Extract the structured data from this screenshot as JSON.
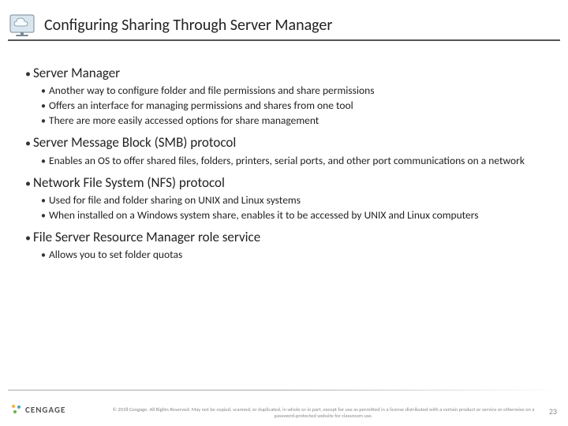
{
  "header": {
    "title": "Configuring Sharing Through Server Manager"
  },
  "icons": {
    "cloud": "cloud-icon",
    "brand_mark": "brand-mark-icon"
  },
  "bullets": [
    {
      "text": "Server Manager",
      "children": [
        "Another way to configure folder and file permissions and share permissions",
        "Offers an interface for managing permissions and shares from one tool",
        "There are more easily accessed options for share management"
      ]
    },
    {
      "text": "Server Message Block (SMB) protocol",
      "children": [
        "Enables an OS to offer shared files, folders, printers, serial ports, and other port communications on a network"
      ]
    },
    {
      "text": "Network File System (NFS) protocol",
      "children": [
        "Used for file and folder sharing on UNIX and Linux systems",
        "When installed on a Windows system share, enables it to be accessed by UNIX and Linux computers"
      ]
    },
    {
      "text": "File Server Resource Manager role service",
      "children": [
        "Allows you to set folder quotas"
      ]
    }
  ],
  "footer": {
    "brand": "CENGAGE",
    "copyright": "© 2018 Cengage. All Rights Reserved. May not be copied, scanned, or duplicated, in whole or in part, except for use as permitted in a license distributed with a certain product or service or otherwise on a password-protected website for classroom use.",
    "page": "23"
  }
}
